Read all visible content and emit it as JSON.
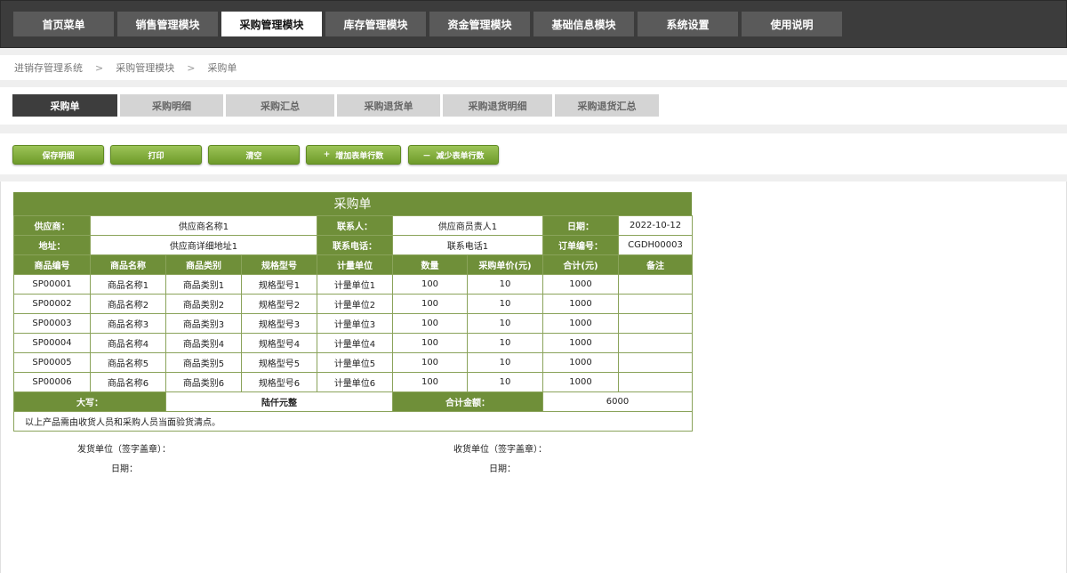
{
  "nav": {
    "items": [
      "首页菜单",
      "销售管理模块",
      "采购管理模块",
      "库存管理模块",
      "资金管理模块",
      "基础信息模块",
      "系统设置",
      "使用说明"
    ],
    "active_index": 2
  },
  "breadcrumb": [
    "进销存管理系统",
    "采购管理模块",
    "采购单"
  ],
  "subtabs": {
    "items": [
      "采购单",
      "采购明细",
      "采购汇总",
      "采购退货单",
      "采购退货明细",
      "采购退货汇总"
    ],
    "active_index": 0
  },
  "actions": {
    "save": "保存明细",
    "print": "打印",
    "clear": "清空",
    "add_rows": "增加表单行数",
    "add_glyph": "+",
    "remove_rows": "减少表单行数",
    "remove_glyph": "－"
  },
  "form": {
    "title": "采购单",
    "header": {
      "supplier_label": "供应商：",
      "supplier_value": "供应商名称1",
      "contact_label": "联系人：",
      "contact_value": "供应商员责人1",
      "date_label": "日期：",
      "date_value": "2022-10-12",
      "address_label": "地址：",
      "address_value": "供应商详细地址1",
      "phone_label": "联系电话：",
      "phone_value": "联系电话1",
      "order_no_label": "订单编号：",
      "order_no_value": "CGDH00003"
    },
    "columns": [
      "商品编号",
      "商品名称",
      "商品类别",
      "规格型号",
      "计量单位",
      "数量",
      "采购单价(元)",
      "合计(元)",
      "备注"
    ],
    "rows": [
      [
        "SP00001",
        "商品名称1",
        "商品类别1",
        "规格型号1",
        "计量单位1",
        "100",
        "10",
        "1000",
        ""
      ],
      [
        "SP00002",
        "商品名称2",
        "商品类别2",
        "规格型号2",
        "计量单位2",
        "100",
        "10",
        "1000",
        ""
      ],
      [
        "SP00003",
        "商品名称3",
        "商品类别3",
        "规格型号3",
        "计量单位3",
        "100",
        "10",
        "1000",
        ""
      ],
      [
        "SP00004",
        "商品名称4",
        "商品类别4",
        "规格型号4",
        "计量单位4",
        "100",
        "10",
        "1000",
        ""
      ],
      [
        "SP00005",
        "商品名称5",
        "商品类别5",
        "规格型号5",
        "计量单位5",
        "100",
        "10",
        "1000",
        ""
      ],
      [
        "SP00006",
        "商品名称6",
        "商品类别6",
        "规格型号6",
        "计量单位6",
        "100",
        "10",
        "1000",
        ""
      ]
    ],
    "footer": {
      "caps_label": "大写：",
      "caps_value": "陆仟元整",
      "total_label": "合计金额：",
      "total_value": "6000",
      "note": "以上产品需由收货人员和采购人员当面验货清点。"
    },
    "signatures": {
      "sender": "发货单位（签字盖章）：",
      "sender_date": "日期：",
      "receiver": "收货单位（签字盖章）：",
      "receiver_date": "日期："
    }
  },
  "colors": {
    "nav_bg": "#3c3c3c",
    "nav_item": "#5a5a5a",
    "accent_green": "#6f8f39",
    "button_green": "#7faa38",
    "tab_active": "#3d3d3d",
    "tab_inactive": "#d4d4d4"
  }
}
